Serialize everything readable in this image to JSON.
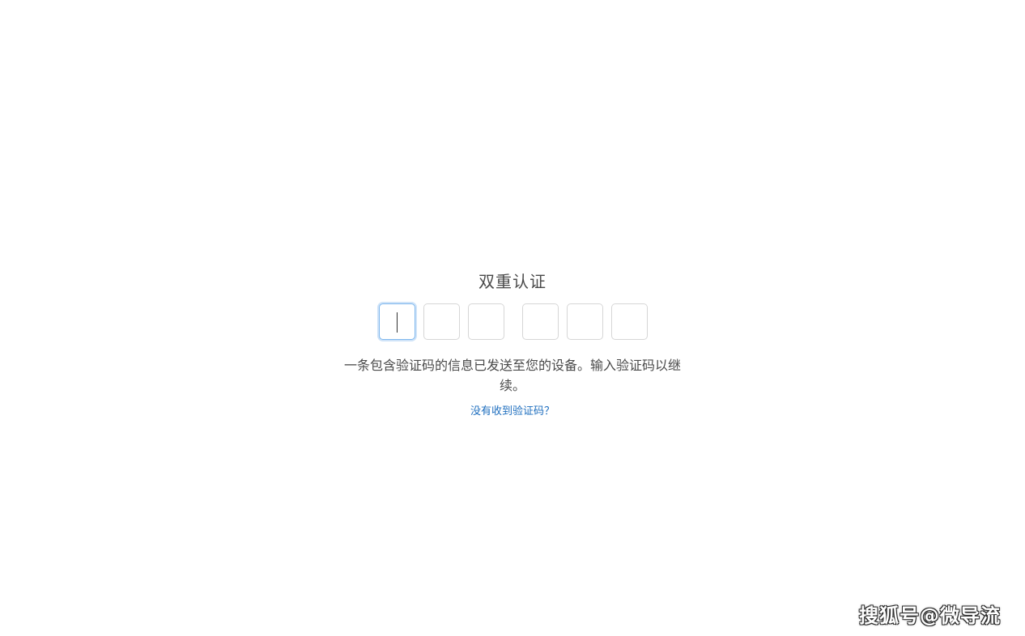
{
  "auth": {
    "title": "双重认证",
    "message": "一条包含验证码的信息已发送至您的设备。输入验证码以继续。",
    "help_link": "没有收到验证码？",
    "code_groups": [
      [
        "",
        "",
        ""
      ],
      [
        "",
        "",
        ""
      ]
    ],
    "active_digit_index": 0
  },
  "watermark": {
    "text": "搜狐号@微导流"
  },
  "colors": {
    "link": "#1f6fbf",
    "active_border": "#7fb8ee",
    "box_border": "#d6d6d6",
    "text": "#4a4a4a"
  }
}
